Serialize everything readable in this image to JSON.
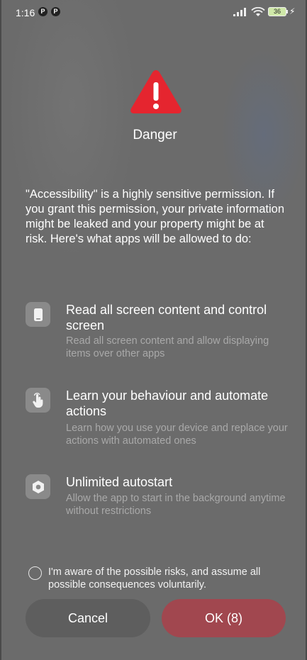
{
  "status_bar": {
    "time": "1:16",
    "app_icon_1": "P",
    "app_icon_2": "P",
    "battery_level": "36"
  },
  "dialog": {
    "title": "Danger",
    "icon": "warning-triangle-icon",
    "accent_color": "#e5252f",
    "description": "\"Accessibility\" is a highly sensitive permission. If you grant this permission, your private information might be leaked and your property might be at risk. Here's what apps will be allowed to do:",
    "permissions": [
      {
        "icon": "phone-screen-icon",
        "title": "Read all screen content and control screen",
        "description": "Read all screen content and allow displaying items over other apps"
      },
      {
        "icon": "touch-hand-icon",
        "title": "Learn your behaviour and automate actions",
        "description": "Learn how you use your device and replace your actions with automated ones"
      },
      {
        "icon": "autostart-hexagon-icon",
        "title": "Unlimited autostart",
        "description": "Allow the app to start in the background anytime without restrictions"
      }
    ],
    "agree_text": "I'm aware of the possible risks, and assume all possible consequences voluntarily.",
    "cancel_label": "Cancel",
    "ok_label": "OK (8)"
  }
}
